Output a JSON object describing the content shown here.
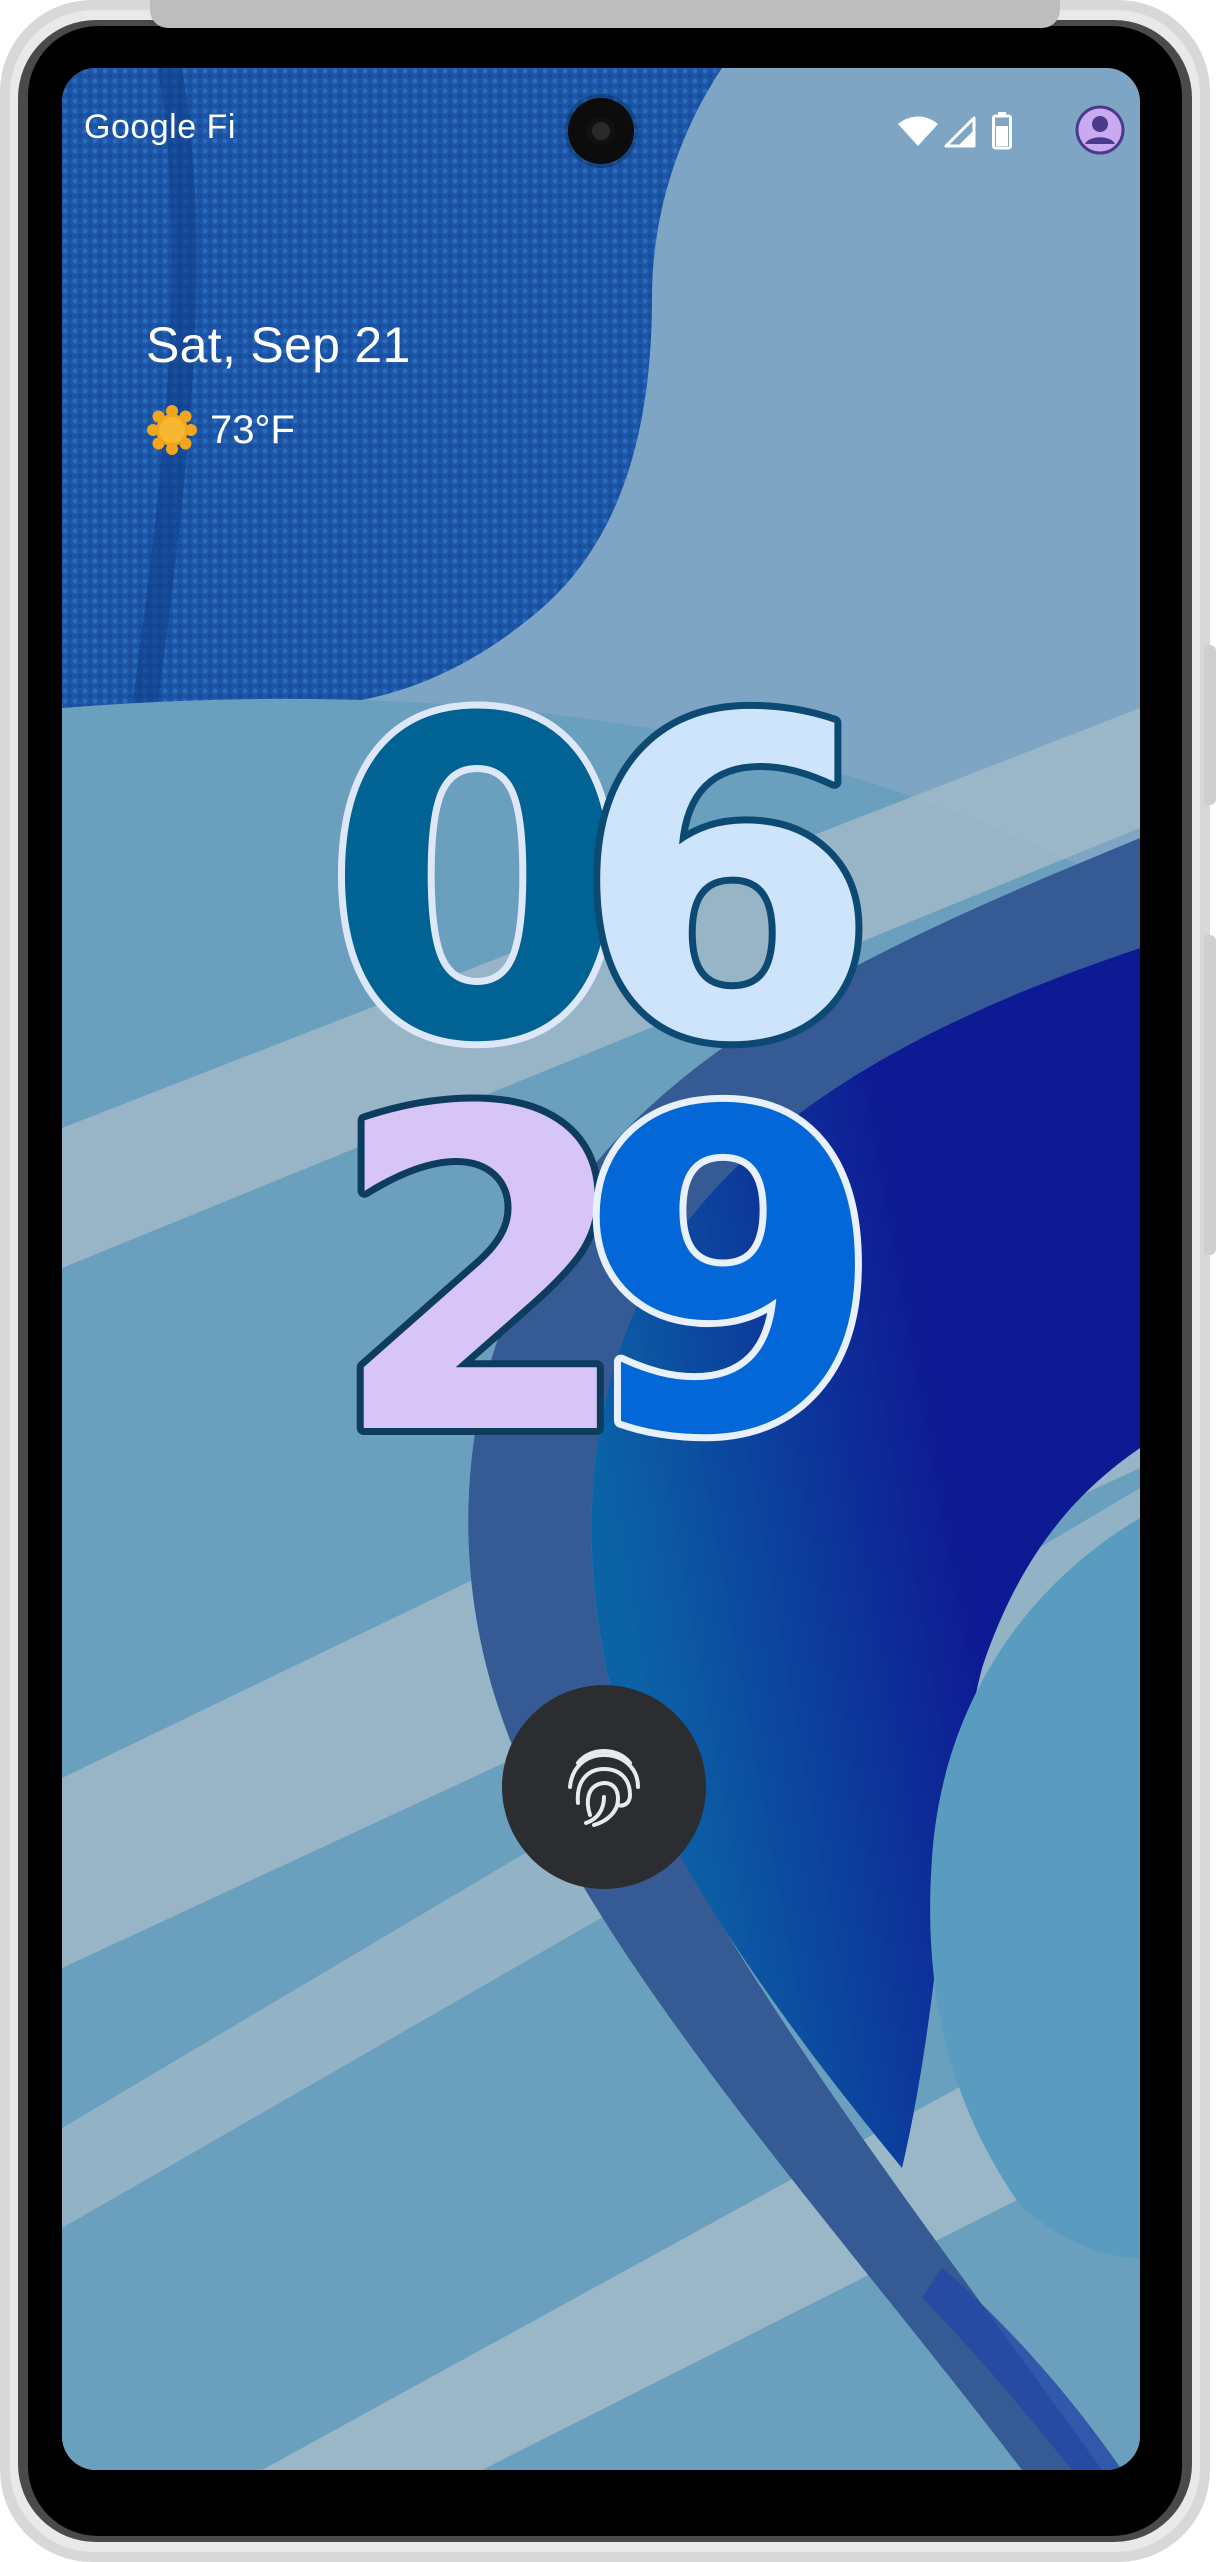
{
  "status_bar": {
    "carrier": "Google Fi",
    "icons": [
      "wifi-icon",
      "cell-signal-icon",
      "battery-icon",
      "account-icon"
    ]
  },
  "lock_screen": {
    "date": "Sat, Sep 21",
    "weather": {
      "icon": "sun-icon",
      "temperature": "73°F"
    },
    "clock": {
      "hour_digits": [
        "0",
        "6"
      ],
      "minute_digits": [
        "2",
        "9"
      ]
    },
    "fingerprint": {
      "icon": "fingerprint-icon"
    }
  },
  "colors": {
    "digit_1": "#006394",
    "digit_2": "#cde4fa",
    "digit_3": "#d8c5f7",
    "digit_4": "#0367d8",
    "wallpaper_dark_blue": "#0e1a93",
    "wallpaper_band": "#365a94"
  }
}
